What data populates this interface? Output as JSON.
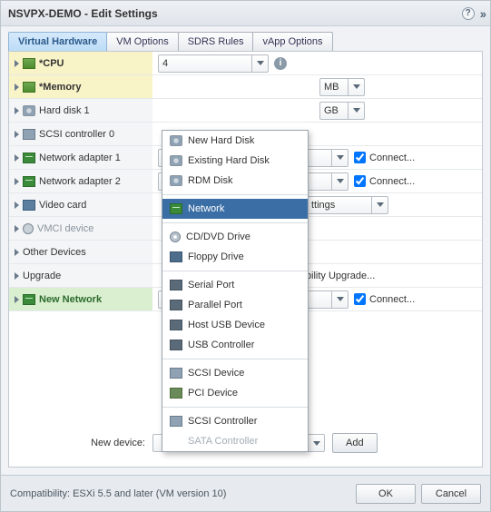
{
  "title": "NSVPX-DEMO - Edit Settings",
  "tabs": {
    "t0": "Virtual Hardware",
    "t1": "VM Options",
    "t2": "SDRS Rules",
    "t3": "vApp Options"
  },
  "rows": {
    "cpu": {
      "label": "*CPU",
      "value": "4"
    },
    "mem": {
      "label": "*Memory",
      "unit": "MB"
    },
    "hd1": {
      "label": "Hard disk 1",
      "unit": "GB"
    },
    "scsi0": {
      "label": "SCSI controller 0"
    },
    "na1": {
      "label": "Network adapter 1",
      "connect": "Connect..."
    },
    "na2": {
      "label": "Network adapter 2",
      "connect": "Connect..."
    },
    "video": {
      "label": "Video card",
      "value_fragment": "ttings"
    },
    "vmci": {
      "label": "VMCI device"
    },
    "other": {
      "label": "Other Devices"
    },
    "upgrade": {
      "label": "Upgrade",
      "value_fragment": "mpatibility Upgrade..."
    },
    "newnet": {
      "label": "New Network",
      "connect": "Connect..."
    }
  },
  "popup": {
    "nhd": "New Hard Disk",
    "ehd": "Existing Hard Disk",
    "rdm": "RDM Disk",
    "net": "Network",
    "cd": "CD/DVD Drive",
    "floppy": "Floppy Drive",
    "serial": "Serial Port",
    "parallel": "Parallel Port",
    "husb": "Host USB Device",
    "usbc": "USB Controller",
    "scsid": "SCSI Device",
    "pcid": "PCI Device",
    "scsic": "SCSI Controller",
    "satac": "SATA Controller"
  },
  "newdevice": {
    "label": "New device:",
    "selected": "Network",
    "add": "Add"
  },
  "footer": {
    "compat": "Compatibility: ESXi 5.5 and later (VM version 10)",
    "ok": "OK",
    "cancel": "Cancel"
  }
}
